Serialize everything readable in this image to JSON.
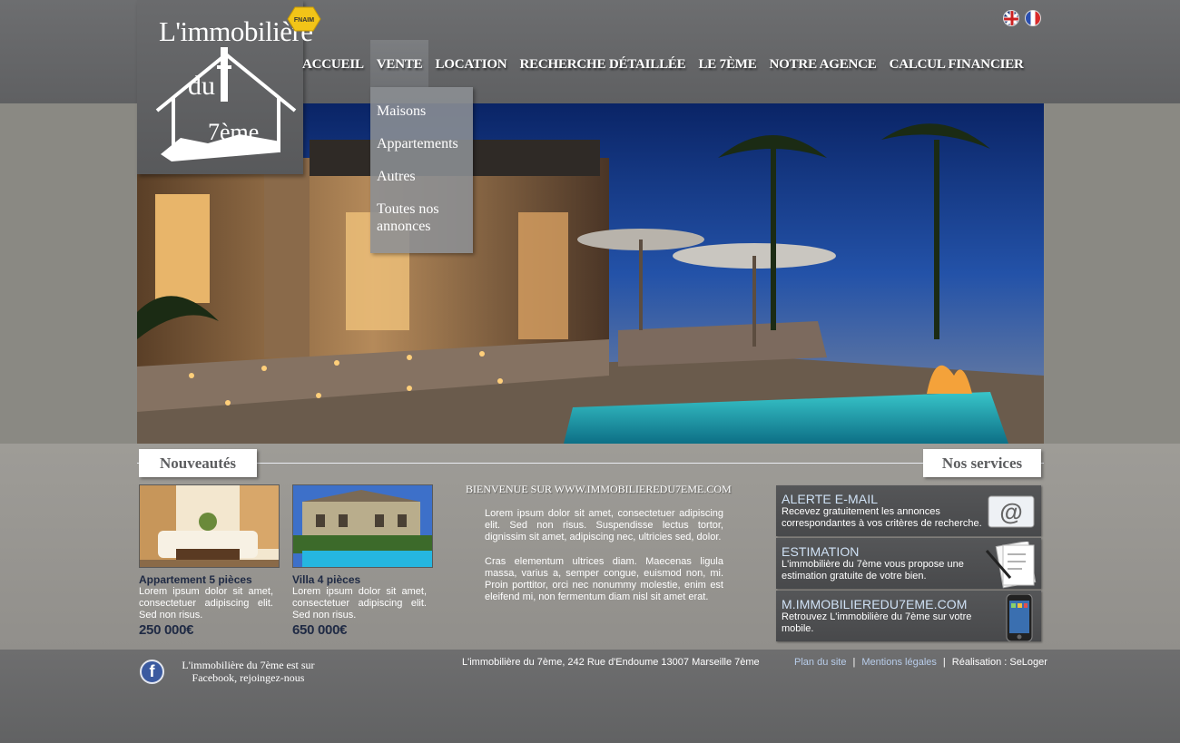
{
  "logo": {
    "title": "L'immobilière",
    "du": "du",
    "seventh": "7ème",
    "badge": "FNAIM"
  },
  "languages": [
    {
      "name": "english-flag"
    },
    {
      "name": "french-flag"
    }
  ],
  "nav": {
    "items": [
      "ACCUEIL",
      "VENTE",
      "LOCATION",
      "RECHERCHE DÉTAILLÉE",
      "LE 7ÈME",
      "NOTRE AGENCE",
      "CALCUL FINANCIER"
    ],
    "active": "VENTE",
    "dropdown": [
      "Maisons",
      "Appartements",
      "Autres",
      "Toutes nos annonces"
    ]
  },
  "sections": {
    "news": "Nouveautés",
    "services": "Nos services"
  },
  "listings": [
    {
      "title": "Appartement 5 pièces",
      "desc": "Lorem ipsum dolor sit amet, consectetuer adipiscing elit. Sed non risus.",
      "price": "250 000€"
    },
    {
      "title": "Villa 4 pièces",
      "desc": "Lorem ipsum dolor sit amet, consectetuer adipiscing elit. Sed non risus.",
      "price": "650 000€"
    }
  ],
  "welcome": {
    "title": "BIENVENUE SUR WWW.IMMOBILIEREDU7EME.COM",
    "p1": "Lorem ipsum dolor sit amet, consectetuer adipiscing elit. Sed non risus. Suspendisse lectus tortor, dignissim sit amet, adipiscing nec, ultricies sed, dolor.",
    "p2": "Cras elementum ultrices diam. Maecenas ligula massa, varius a, semper congue, euismod non, mi. Proin porttitor, orci nec nonummy molestie, enim est eleifend mi, non fermentum diam nisl sit amet erat."
  },
  "services": [
    {
      "title": "ALERTE E-MAIL",
      "desc": "Recevez gratuitement les annonces correspondantes à vos critères de recherche.",
      "icon": "email-icon"
    },
    {
      "title": "ESTIMATION",
      "desc": "L'immobilière du 7ème vous propose une estimation gratuite de votre bien.",
      "icon": "document-pen-icon"
    },
    {
      "title": "M.IMMOBILIEREDU7EME.COM",
      "desc": "Retrouvez L'immobilière du 7ème sur votre mobile.",
      "icon": "smartphone-icon"
    }
  ],
  "footer": {
    "facebook": "L'immobilière du 7ème est sur Facebook, rejoingez-nous",
    "address": "L'immobilière du 7ème, 242 Rue d'Endoume 13007 Marseille 7ème",
    "links": {
      "sitemap": "Plan du site",
      "legal": "Mentions légales",
      "credit": "Réalisation : SeLoger"
    }
  }
}
